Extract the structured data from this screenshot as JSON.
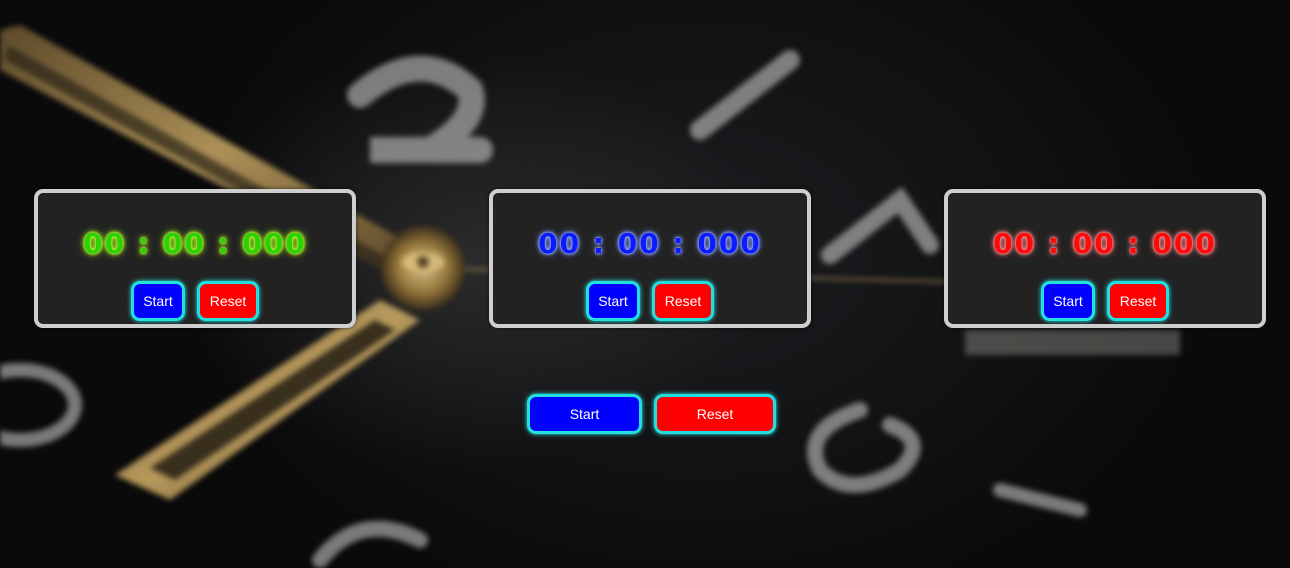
{
  "timers": [
    {
      "id": "timer-1",
      "time": "00 : 00 : 000",
      "color": "#2bd400",
      "start_label": "Start",
      "reset_label": "Reset"
    },
    {
      "id": "timer-2",
      "time": "00 : 00 : 000",
      "color": "#0a1cff",
      "start_label": "Start",
      "reset_label": "Reset"
    },
    {
      "id": "timer-3",
      "time": "00 : 00 : 000",
      "color": "#ff0a0a",
      "start_label": "Start",
      "reset_label": "Reset"
    }
  ],
  "global_controls": {
    "start_label": "Start",
    "reset_label": "Reset"
  },
  "colors": {
    "start_button": "#0000ff",
    "reset_button": "#ff0000",
    "button_glow": "#22e0e0",
    "card_background": "#222222",
    "card_border": "#cfcfcf"
  },
  "background": {
    "description_icon": "watch-face-background",
    "numerals": [
      "2",
      "3",
      "4",
      "0",
      "6",
      "8"
    ]
  }
}
